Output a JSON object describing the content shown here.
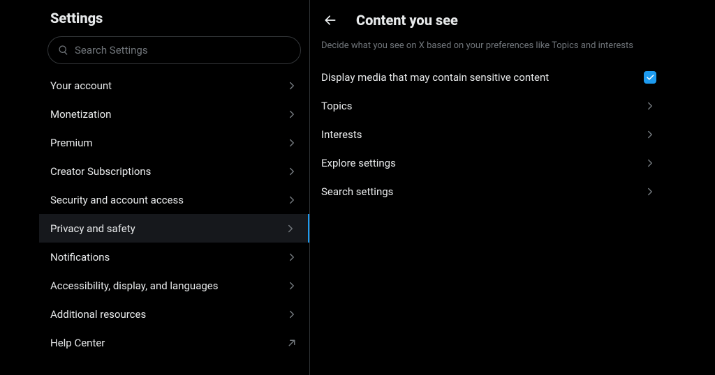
{
  "settings": {
    "title": "Settings",
    "search_placeholder": "Search Settings",
    "items": [
      {
        "label": "Your account"
      },
      {
        "label": "Monetization"
      },
      {
        "label": "Premium"
      },
      {
        "label": "Creator Subscriptions"
      },
      {
        "label": "Security and account access"
      },
      {
        "label": "Privacy and safety",
        "selected": true
      },
      {
        "label": "Notifications"
      },
      {
        "label": "Accessibility, display, and languages"
      },
      {
        "label": "Additional resources"
      },
      {
        "label": "Help Center",
        "external": true
      }
    ]
  },
  "content": {
    "title": "Content you see",
    "subtitle": "Decide what you see on X based on your preferences like Topics and interests",
    "sensitive_label": "Display media that may contain sensitive content",
    "sensitive_checked": true,
    "links": [
      {
        "label": "Topics"
      },
      {
        "label": "Interests"
      },
      {
        "label": "Explore settings"
      },
      {
        "label": "Search settings"
      }
    ]
  }
}
